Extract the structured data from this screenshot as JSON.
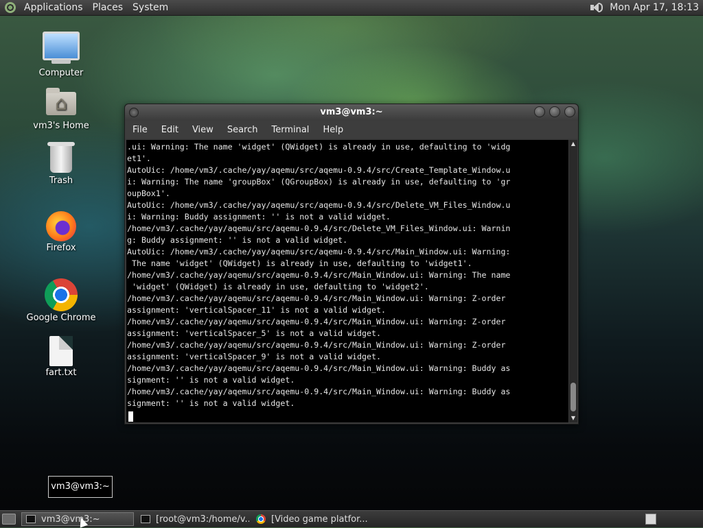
{
  "top_panel": {
    "menus": [
      "Applications",
      "Places",
      "System"
    ],
    "clock": "Mon Apr 17, 18:13"
  },
  "desktop_icons": [
    {
      "label": "Computer",
      "icon": "computer-icon"
    },
    {
      "label": "vm3's Home",
      "icon": "home-folder-icon"
    },
    {
      "label": "Trash",
      "icon": "trash-icon"
    },
    {
      "label": "Firefox",
      "icon": "firefox-icon"
    },
    {
      "label": "Google Chrome",
      "icon": "chrome-icon"
    },
    {
      "label": "fart.txt",
      "icon": "text-file-icon"
    }
  ],
  "terminal": {
    "title": "vm3@vm3:~",
    "menu": [
      "File",
      "Edit",
      "View",
      "Search",
      "Terminal",
      "Help"
    ],
    "lines": [
      ".ui: Warning: The name 'widget' (QWidget) is already in use, defaulting to 'widg",
      "et1'.",
      "AutoUic: /home/vm3/.cache/yay/aqemu/src/aqemu-0.9.4/src/Create_Template_Window.u",
      "i: Warning: The name 'groupBox' (QGroupBox) is already in use, defaulting to 'gr",
      "oupBox1'.",
      "AutoUic: /home/vm3/.cache/yay/aqemu/src/aqemu-0.9.4/src/Delete_VM_Files_Window.u",
      "i: Warning: Buddy assignment: '' is not a valid widget.",
      "/home/vm3/.cache/yay/aqemu/src/aqemu-0.9.4/src/Delete_VM_Files_Window.ui: Warnin",
      "g: Buddy assignment: '' is not a valid widget.",
      "AutoUic: /home/vm3/.cache/yay/aqemu/src/aqemu-0.9.4/src/Main_Window.ui: Warning:",
      " The name 'widget' (QWidget) is already in use, defaulting to 'widget1'.",
      "/home/vm3/.cache/yay/aqemu/src/aqemu-0.9.4/src/Main_Window.ui: Warning: The name",
      " 'widget' (QWidget) is already in use, defaulting to 'widget2'.",
      "/home/vm3/.cache/yay/aqemu/src/aqemu-0.9.4/src/Main_Window.ui: Warning: Z-order",
      "assignment: 'verticalSpacer_11' is not a valid widget.",
      "/home/vm3/.cache/yay/aqemu/src/aqemu-0.9.4/src/Main_Window.ui: Warning: Z-order",
      "assignment: 'verticalSpacer_5' is not a valid widget.",
      "/home/vm3/.cache/yay/aqemu/src/aqemu-0.9.4/src/Main_Window.ui: Warning: Z-order",
      "assignment: 'verticalSpacer_9' is not a valid widget.",
      "/home/vm3/.cache/yay/aqemu/src/aqemu-0.9.4/src/Main_Window.ui: Warning: Buddy as",
      "signment: '' is not a valid widget.",
      "/home/vm3/.cache/yay/aqemu/src/aqemu-0.9.4/src/Main_Window.ui: Warning: Buddy as",
      "signment: '' is not a valid widget."
    ]
  },
  "tooltip": "vm3@vm3:~",
  "taskbar": {
    "tasks": [
      {
        "label": "vm3@vm3:~",
        "icon": "terminal-icon",
        "active": true
      },
      {
        "label": "[root@vm3:/home/v...",
        "icon": "terminal-icon",
        "active": false
      },
      {
        "label": "[Video game platfor...",
        "icon": "chrome-icon",
        "active": false
      }
    ]
  }
}
